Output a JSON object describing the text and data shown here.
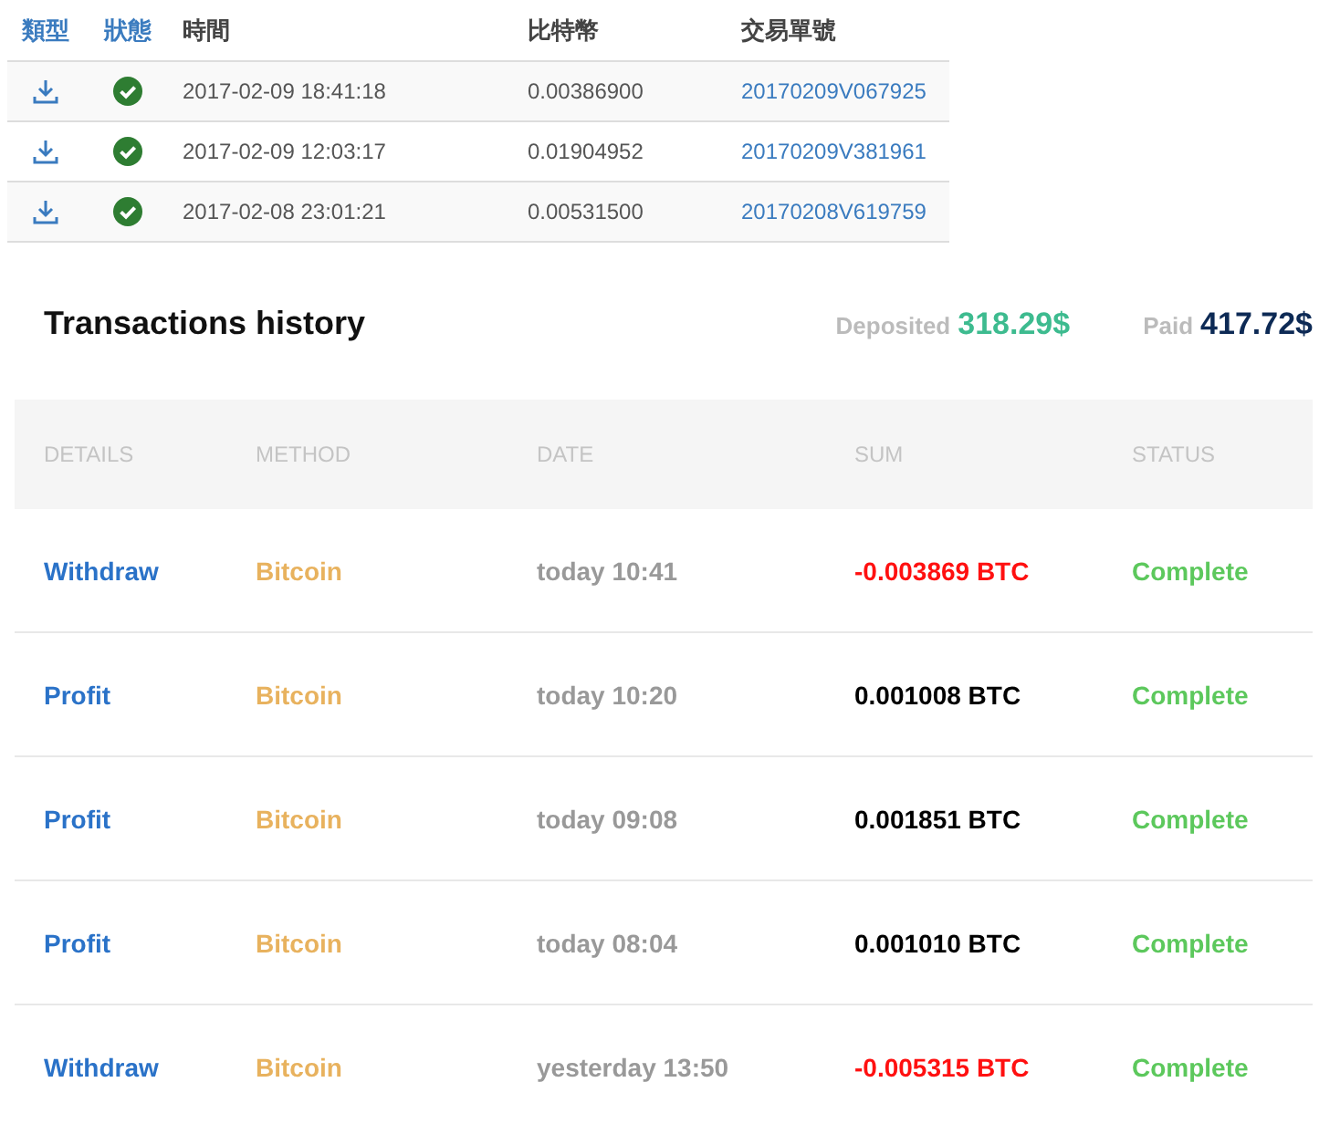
{
  "orders": {
    "columns": [
      "類型",
      "狀態",
      "時間",
      "比特幣",
      "交易單號"
    ],
    "rows": [
      {
        "time": "2017-02-09 18:41:18",
        "btc": "0.00386900",
        "order_id": "20170209V067925",
        "complete": true
      },
      {
        "time": "2017-02-09 12:03:17",
        "btc": "0.01904952",
        "order_id": "20170209V381961",
        "complete": true
      },
      {
        "time": "2017-02-08 23:01:21",
        "btc": "0.00531500",
        "order_id": "20170208V619759",
        "complete": true
      }
    ]
  },
  "history": {
    "title": "Transactions history",
    "deposited_label": "Deposited",
    "deposited": "318.29$",
    "paid_label": "Paid",
    "paid": "417.72$",
    "columns": [
      "DETAILS",
      "METHOD",
      "DATE",
      "SUM",
      "STATUS"
    ],
    "rows": [
      {
        "details": "Withdraw",
        "method": "Bitcoin",
        "date": "today 10:41",
        "sum": "-0.003869 BTC",
        "negative": true,
        "status": "Complete"
      },
      {
        "details": "Profit",
        "method": "Bitcoin",
        "date": "today 10:20",
        "sum": "0.001008 BTC",
        "negative": false,
        "status": "Complete"
      },
      {
        "details": "Profit",
        "method": "Bitcoin",
        "date": "today 09:08",
        "sum": "0.001851 BTC",
        "negative": false,
        "status": "Complete"
      },
      {
        "details": "Profit",
        "method": "Bitcoin",
        "date": "today 08:04",
        "sum": "0.001010 BTC",
        "negative": false,
        "status": "Complete"
      },
      {
        "details": "Withdraw",
        "method": "Bitcoin",
        "date": "yesterday 13:50",
        "sum": "-0.005315 BTC",
        "negative": true,
        "status": "Complete"
      }
    ]
  }
}
